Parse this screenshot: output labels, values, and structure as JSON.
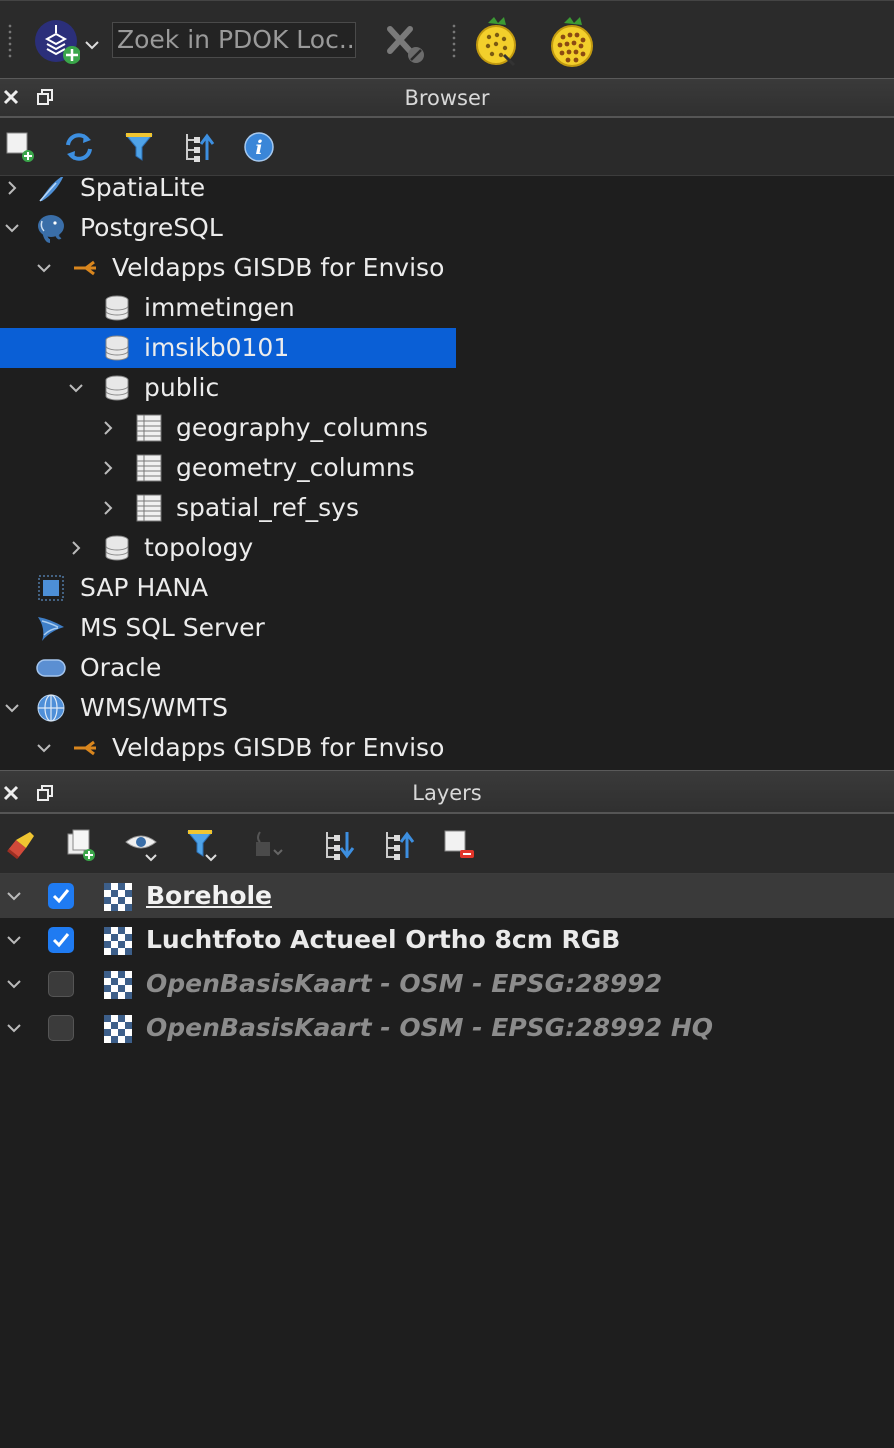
{
  "toolbar": {
    "search_placeholder": "Zoek in PDOK Loc...",
    "icons": [
      "pdok-locator-icon",
      "clear-search-icon",
      "pin-icon",
      "pin-icon"
    ]
  },
  "browser": {
    "title": "Browser",
    "toolbar_icons": [
      "add-layer-icon",
      "refresh-icon",
      "filter-icon",
      "collapse-all-icon",
      "info-icon"
    ],
    "items": [
      {
        "label": "SpatiaLite",
        "expanded": false
      },
      {
        "label": "PostgreSQL",
        "expanded": true
      },
      {
        "label": "Veldapps GISDB for Enviso",
        "expanded": true
      },
      {
        "label": "immetingen"
      },
      {
        "label": "imsikb0101",
        "selected": true
      },
      {
        "label": "public",
        "expanded": true
      },
      {
        "label": "geography_columns",
        "expanded": false
      },
      {
        "label": "geometry_columns",
        "expanded": false
      },
      {
        "label": "spatial_ref_sys",
        "expanded": false
      },
      {
        "label": "topology",
        "expanded": false
      },
      {
        "label": "SAP HANA"
      },
      {
        "label": "MS SQL Server"
      },
      {
        "label": "Oracle"
      },
      {
        "label": "WMS/WMTS",
        "expanded": true
      },
      {
        "label": "Veldapps GISDB for Enviso",
        "expanded": true
      }
    ]
  },
  "layers": {
    "title": "Layers",
    "toolbar_icons": [
      "style-brush-icon",
      "add-group-icon",
      "visibility-icon",
      "filter-legend-icon",
      "expression-filter-icon",
      "expand-all-icon",
      "collapse-all-icon",
      "remove-layer-icon"
    ],
    "items": [
      {
        "label": "Borehole",
        "checked": true,
        "active": true
      },
      {
        "label": "Luchtfoto Actueel Ortho 8cm RGB",
        "checked": true
      },
      {
        "label": "OpenBasisKaart - OSM - EPSG:28992",
        "checked": false
      },
      {
        "label": "OpenBasisKaart - OSM - EPSG:28992 HQ",
        "checked": false
      }
    ]
  },
  "colors": {
    "selection": "#0a5fd6",
    "checkbox_on": "#1f7bf2",
    "background": "#1e1e1e"
  }
}
